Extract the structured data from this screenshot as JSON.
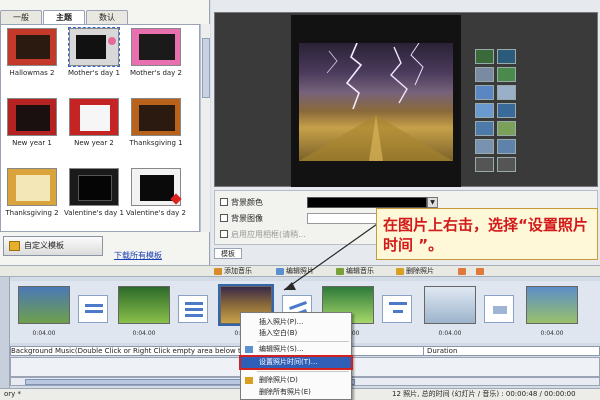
{
  "tabs": [
    "一般",
    "主题",
    "数认"
  ],
  "templates": [
    {
      "caption": "Hallowmas 2"
    },
    {
      "caption": "Mother's day 1"
    },
    {
      "caption": "Mother's day 2"
    },
    {
      "caption": "New year 1"
    },
    {
      "caption": "New year 2"
    },
    {
      "caption": "Thanksgiving 1"
    },
    {
      "caption": "Thanksgiving 2"
    },
    {
      "caption": "Valentine's day 1"
    },
    {
      "caption": "Valentine's day 2"
    }
  ],
  "custom_template_button": "自定义模板",
  "download_link": "下载所有模板",
  "preview": {
    "controls": "◀ ■ ▶ ▶"
  },
  "options": {
    "bg_color": "背景颜色",
    "bg_image": "背景图像",
    "disabled_option": "启用应用相框(请稍...",
    "panel_tab": "模板"
  },
  "toolbar": {
    "add_music": "添加音乐",
    "edit_photo": "编辑照片",
    "edit_music": "编辑音乐",
    "delete_photo": "删除照片"
  },
  "timeline": {
    "durations": [
      "0:04.00",
      "0:04.00",
      "0:04.00",
      "0:04.00",
      "0:04.00",
      "0:04.00"
    ],
    "music_hint": "Background Music(Double Click or Right Click empty area below to Add M",
    "duration_label": "Duration"
  },
  "context_menu": {
    "insert_photo": "插入照片(P)...",
    "insert_blank": "插入空白(B)",
    "edit_photo": "编辑照片(S)...",
    "set_photo_time": "设置照片时间(T)...",
    "delete_photo": "删除照片(D)",
    "delete_all": "删除所有照片(E)"
  },
  "status": {
    "left": "ory *",
    "right": "12 照片, 总的时间 (幻灯片 / 音乐) : 00:00:48 / 00:00:00"
  },
  "callout": "在图片上右击，选择“设置照片时间 ”。",
  "colors": {
    "accent": "#2f5fb7",
    "callout_text": "#d21a1a",
    "callout_bg": "#fff8d8"
  }
}
